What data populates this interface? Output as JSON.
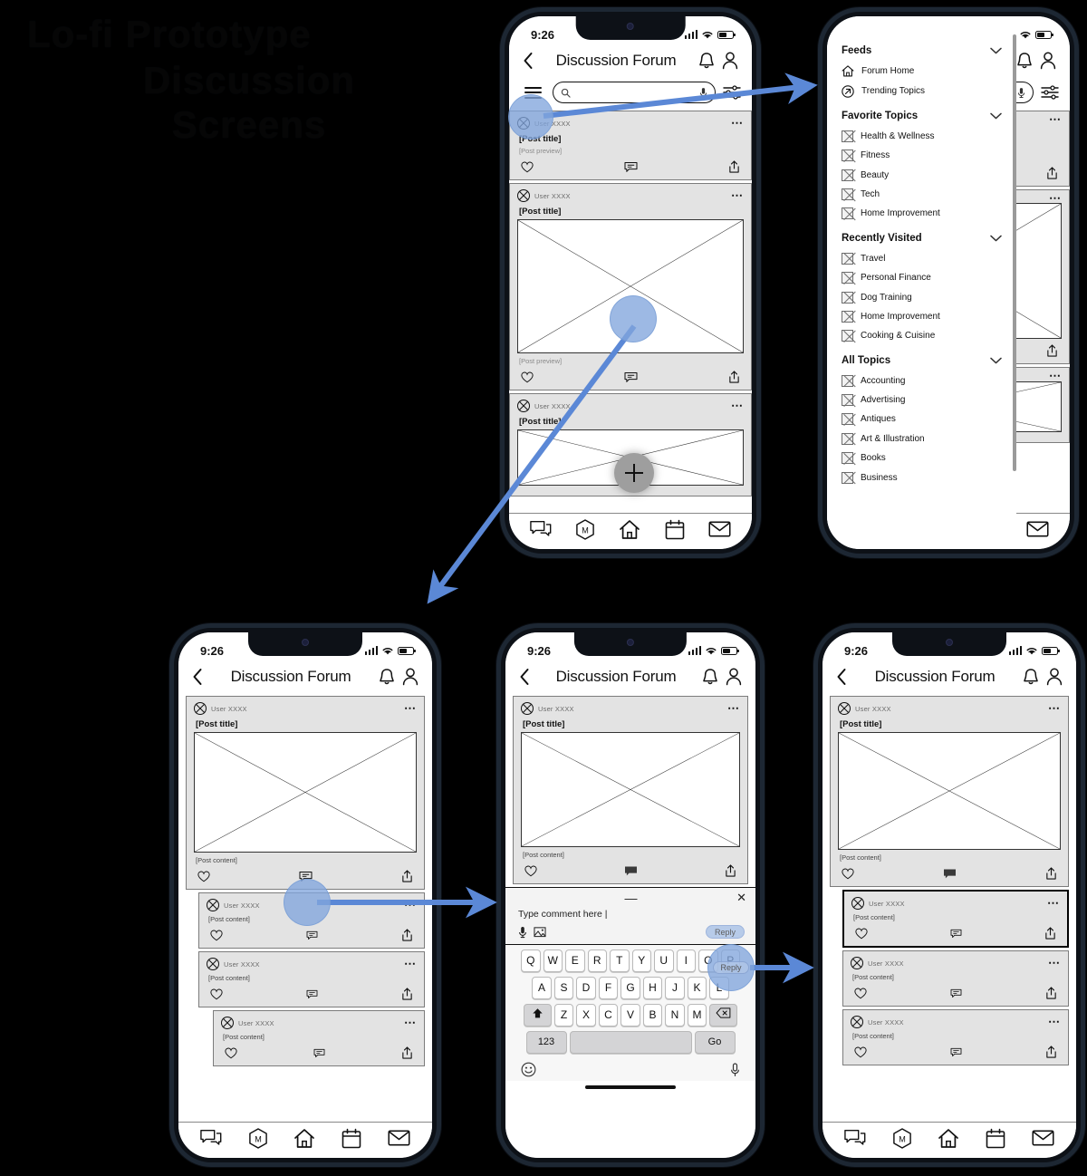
{
  "title": {
    "line1": "Lo-fi Prototype",
    "line2": "Discussion",
    "line3": "Screens"
  },
  "colors": {
    "arrow_blue": "#5b88d6",
    "hotspot_blue": "#a7c0e6",
    "post_gray": "#e3e3e3",
    "fab_gray": "#9e9e9e",
    "key_gray": "#d4d4d6"
  },
  "status": {
    "time": "9:26",
    "signal_icon": "signal-bars-icon",
    "wifi_icon": "wifi-icon",
    "battery_icon": "battery-icon"
  },
  "header": {
    "back_icon": "back-chevron-icon",
    "title": "Discussion Forum",
    "bell_icon": "notification-bell-icon",
    "profile_icon": "user-profile-icon"
  },
  "search": {
    "menu_icon": "hamburger-menu-icon",
    "search_icon": "search-icon",
    "placeholder": "",
    "mic_icon": "microphone-icon",
    "filter_icon": "filter-sliders-icon"
  },
  "bottom_nav": [
    {
      "name": "messages",
      "icon": "chat-bubbles-icon",
      "label": ""
    },
    {
      "name": "hub",
      "icon": "hexagon-m-icon",
      "label": "M"
    },
    {
      "name": "home",
      "icon": "home-icon",
      "label": ""
    },
    {
      "name": "calendar",
      "icon": "calendar-icon",
      "label": ""
    },
    {
      "name": "mail",
      "icon": "envelope-icon",
      "label": ""
    }
  ],
  "post_labels": {
    "user": "User XXXX",
    "title": "[Post title]",
    "preview": "[Post preview]",
    "content": "[Post content]",
    "more_icon": "more-options-icon",
    "like_icon": "heart-icon",
    "comment_icon": "comment-icon",
    "share_icon": "share-icon"
  },
  "screen1": {
    "fab_label": "+",
    "fab_icon": "add-post-fab-icon",
    "posts": [
      {
        "user": "User XXXX",
        "title": "[Post title]",
        "preview": "[Post preview]",
        "has_image": false
      },
      {
        "user": "User XXXX",
        "title": "[Post title]",
        "preview": "[Post preview]",
        "has_image": true
      },
      {
        "user": "User XXXX",
        "title": "[Post title]",
        "preview": "",
        "has_image": true
      }
    ]
  },
  "drawer": {
    "sections": [
      {
        "name": "Feeds",
        "chevron_icon": "chevron-down-icon",
        "items": [
          {
            "label": "Forum Home",
            "icon": "home-icon"
          },
          {
            "label": "Trending Topics",
            "icon": "trending-arrow-icon"
          }
        ]
      },
      {
        "name": "Favorite Topics",
        "chevron_icon": "chevron-down-icon",
        "items": [
          {
            "label": "Health & Wellness",
            "icon": "placeholder-square-icon"
          },
          {
            "label": "Fitness",
            "icon": "placeholder-square-icon"
          },
          {
            "label": "Beauty",
            "icon": "placeholder-square-icon"
          },
          {
            "label": "Tech",
            "icon": "placeholder-square-icon"
          },
          {
            "label": "Home Improvement",
            "icon": "placeholder-square-icon"
          }
        ]
      },
      {
        "name": "Recently Visited",
        "chevron_icon": "chevron-down-icon",
        "items": [
          {
            "label": "Travel",
            "icon": "placeholder-square-icon"
          },
          {
            "label": "Personal Finance",
            "icon": "placeholder-square-icon"
          },
          {
            "label": "Dog Training",
            "icon": "placeholder-square-icon"
          },
          {
            "label": "Home Improvement",
            "icon": "placeholder-square-icon"
          },
          {
            "label": "Cooking & Cuisine",
            "icon": "placeholder-square-icon"
          }
        ]
      },
      {
        "name": "All Topics",
        "chevron_icon": "chevron-down-icon",
        "items": [
          {
            "label": "Accounting",
            "icon": "placeholder-square-icon"
          },
          {
            "label": "Advertising",
            "icon": "placeholder-square-icon"
          },
          {
            "label": "Antiques",
            "icon": "placeholder-square-icon"
          },
          {
            "label": "Art & Illustration",
            "icon": "placeholder-square-icon"
          },
          {
            "label": "Books",
            "icon": "placeholder-square-icon"
          },
          {
            "label": "Business",
            "icon": "placeholder-square-icon"
          }
        ]
      }
    ]
  },
  "screen3": {
    "main_post": {
      "user": "User XXXX",
      "title": "[Post title]",
      "content": "[Post content]"
    },
    "comments": [
      {
        "user": "User XXXX",
        "content": "[Post content]",
        "indent": 0,
        "highlight": false
      },
      {
        "user": "User XXXX",
        "content": "[Post content]",
        "indent": 0,
        "highlight": false
      },
      {
        "user": "User XXXX",
        "content": "[Post content]",
        "indent": 1,
        "highlight": false
      }
    ]
  },
  "screen4": {
    "main_post": {
      "user": "User XXXX",
      "title": "[Post title]",
      "content": "[Post content]"
    },
    "composer": {
      "minimize_icon": "minimize-icon",
      "close_icon": "close-icon",
      "placeholder": "Type comment here",
      "cursor": "|",
      "mic_icon": "microphone-icon",
      "image_icon": "image-attach-icon",
      "reply_label": "Reply"
    },
    "keyboard": {
      "row1": [
        "Q",
        "W",
        "E",
        "R",
        "T",
        "Y",
        "U",
        "I",
        "O",
        "P"
      ],
      "row2": [
        "A",
        "S",
        "D",
        "F",
        "G",
        "H",
        "J",
        "K",
        "L"
      ],
      "row3": [
        "Z",
        "X",
        "C",
        "V",
        "B",
        "N",
        "M"
      ],
      "shift_icon": "shift-arrow-icon",
      "backspace_icon": "backspace-icon",
      "num_label": "123",
      "space_label": "",
      "go_label": "Go",
      "emoji_icon": "emoji-smiley-icon",
      "dictate_icon": "microphone-icon"
    }
  },
  "screen5": {
    "main_post": {
      "user": "User XXXX",
      "title": "[Post title]",
      "content": "[Post content]"
    },
    "comments": [
      {
        "user": "User XXXX",
        "content": "[Post content]",
        "indent": 0,
        "highlight": true
      },
      {
        "user": "User XXXX",
        "content": "[Post content]",
        "indent": 0,
        "highlight": false
      },
      {
        "user": "User XXXX",
        "content": "[Post content]",
        "indent": 0,
        "highlight": false
      }
    ]
  },
  "hotspots": [
    {
      "name": "menu-hotspot",
      "label": ""
    },
    {
      "name": "post-image-hotspot",
      "label": ""
    },
    {
      "name": "comment-hotspot",
      "label": ""
    },
    {
      "name": "reply-hotspot",
      "label": "Reply"
    }
  ]
}
